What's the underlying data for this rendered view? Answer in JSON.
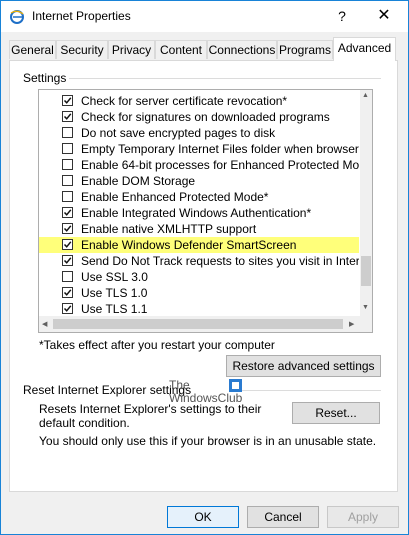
{
  "window": {
    "title": "Internet Properties",
    "help_glyph": "?",
    "close_glyph": "✕"
  },
  "tabs": [
    "General",
    "Security",
    "Privacy",
    "Content",
    "Connections",
    "Programs",
    "Advanced"
  ],
  "settings": {
    "group_label": "Settings",
    "items": [
      {
        "label": "Check for server certificate revocation*",
        "checked": true
      },
      {
        "label": "Check for signatures on downloaded programs",
        "checked": true
      },
      {
        "label": "Do not save encrypted pages to disk",
        "checked": false
      },
      {
        "label": "Empty Temporary Internet Files folder when browser is clo",
        "checked": false
      },
      {
        "label": "Enable 64-bit processes for Enhanced Protected Mode*",
        "checked": false
      },
      {
        "label": "Enable DOM Storage",
        "checked": false
      },
      {
        "label": "Enable Enhanced Protected Mode*",
        "checked": false
      },
      {
        "label": "Enable Integrated Windows Authentication*",
        "checked": true
      },
      {
        "label": "Enable native XMLHTTP support",
        "checked": true
      },
      {
        "label": "Enable Windows Defender SmartScreen",
        "checked": true,
        "highlighted": true
      },
      {
        "label": "Send Do Not Track requests to sites you visit in Internet E",
        "checked": true
      },
      {
        "label": "Use SSL 3.0",
        "checked": false
      },
      {
        "label": "Use TLS 1.0",
        "checked": true
      },
      {
        "label": "Use TLS 1.1",
        "checked": true
      }
    ],
    "note": "*Takes effect after you restart your computer",
    "restore_button": "Restore advanced settings"
  },
  "reset": {
    "group_label": "Reset Internet Explorer settings",
    "description": "Resets Internet Explorer's settings to their default condition.",
    "button": "Reset...",
    "warning": "You should only use this if your browser is in an unusable state."
  },
  "watermark": {
    "line1": "The",
    "line2": "WindowsClub"
  },
  "footer": {
    "ok": "OK",
    "cancel": "Cancel",
    "apply": "Apply"
  },
  "colors": {
    "highlight": "#ffff7a",
    "accent": "#0078d7"
  }
}
